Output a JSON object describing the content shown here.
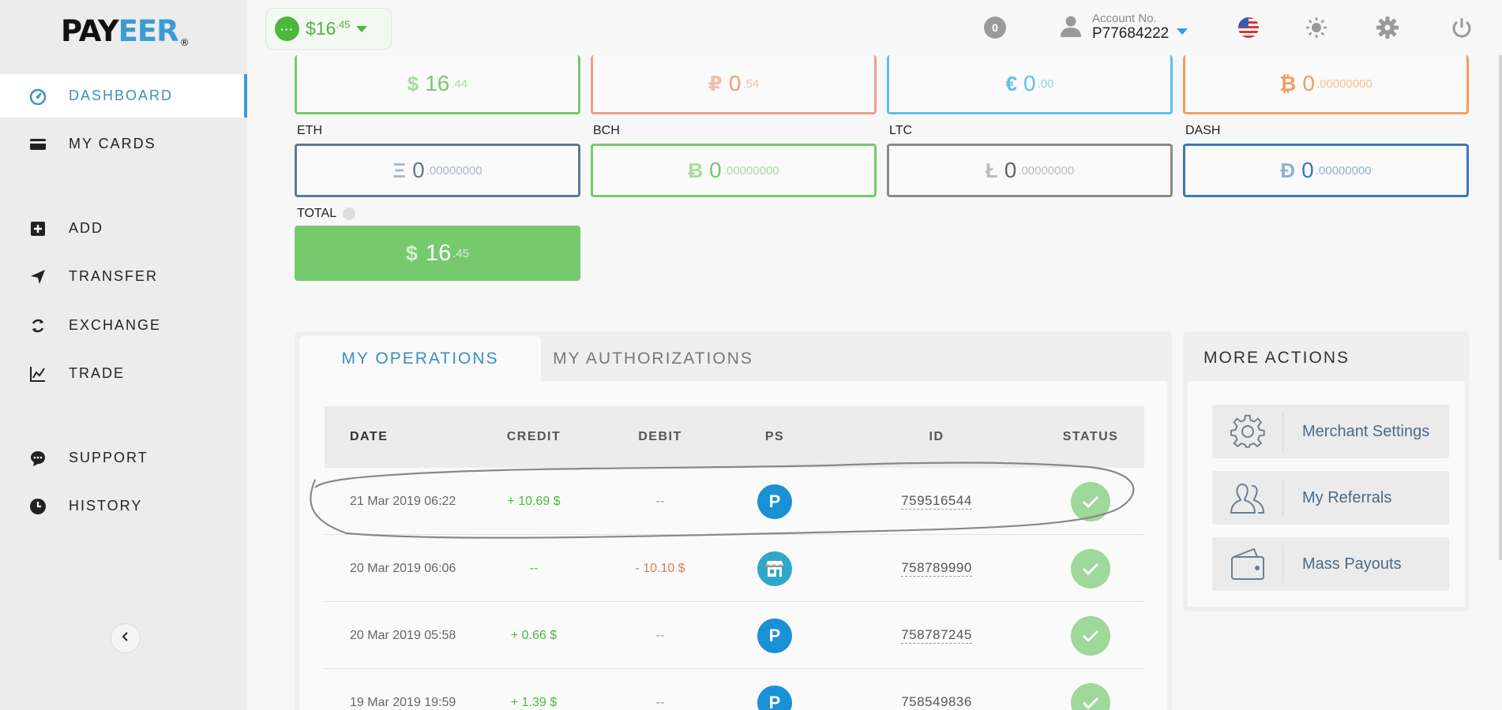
{
  "logo": {
    "part1": "PAY",
    "part2": "EER",
    "mark": "®"
  },
  "sidebar": {
    "items": [
      {
        "label": "DASHBOARD",
        "icon": "dashboard-icon",
        "active": true
      },
      {
        "label": "MY CARDS",
        "icon": "card-icon"
      },
      {
        "label": "ADD",
        "icon": "add-icon"
      },
      {
        "label": "TRANSFER",
        "icon": "transfer-icon"
      },
      {
        "label": "EXCHANGE",
        "icon": "exchange-icon"
      },
      {
        "label": "TRADE",
        "icon": "trade-icon"
      },
      {
        "label": "SUPPORT",
        "icon": "support-icon"
      },
      {
        "label": "HISTORY",
        "icon": "history-icon"
      }
    ],
    "collapse_icon": "chevron-left-icon"
  },
  "topbar": {
    "balance_main": "$16",
    "balance_frac": ".45",
    "notifications": "0",
    "account_label": "Account No.",
    "account_number": "P77684222"
  },
  "wallets": {
    "row1": [
      {
        "symbol": "$",
        "amount": "16",
        "frac": ".44",
        "color": "#77c96d"
      },
      {
        "symbol": "₽",
        "amount": "0",
        "frac": ".54",
        "color": "#e9a08a"
      },
      {
        "symbol": "€",
        "amount": "0",
        "frac": ".00",
        "color": "#5bc2e7"
      },
      {
        "symbol": "₿",
        "amount": "0",
        "frac": ".00000000",
        "color": "#f0a060"
      }
    ],
    "row2": [
      {
        "code": "ETH",
        "symbol": "Ξ",
        "amount": "0",
        "frac": ".00000000",
        "color": "#5e7a95"
      },
      {
        "code": "BCH",
        "symbol": "Ƀ",
        "amount": "0",
        "frac": ".00000000",
        "color": "#77c96d"
      },
      {
        "code": "LTC",
        "symbol": "Ł",
        "amount": "0",
        "frac": ".00000000",
        "color": "#8a8a8a"
      },
      {
        "code": "DASH",
        "symbol": "Đ",
        "amount": "0",
        "frac": ".00000000",
        "color": "#3b78b5"
      }
    ],
    "total_label": "TOTAL",
    "total": {
      "symbol": "$",
      "amount": "16",
      "frac": ".45"
    }
  },
  "operations": {
    "tabs": [
      "MY OPERATIONS",
      "MY AUTHORIZATIONS"
    ],
    "headers": [
      "DATE",
      "CREDIT",
      "DEBIT",
      "PS",
      "ID",
      "STATUS"
    ],
    "rows": [
      {
        "date": "21 Mar 2019 06:22",
        "credit": "+ 10.69 $",
        "debit": "--",
        "ps": "payeer",
        "id": "759516544",
        "status": "ok"
      },
      {
        "date": "20 Mar 2019 06:06",
        "credit": "--",
        "debit": "- 10.10 $",
        "ps": "shop",
        "id": "758789990",
        "status": "ok"
      },
      {
        "date": "20 Mar 2019 05:58",
        "credit": "+ 0.66 $",
        "debit": "--",
        "ps": "payeer",
        "id": "758787245",
        "status": "ok"
      },
      {
        "date": "19 Mar 2019 19:59",
        "credit": "+ 1.39 $",
        "debit": "--",
        "ps": "payeer",
        "id": "758549836",
        "status": "ok"
      }
    ],
    "ps_letter": "P"
  },
  "more_actions": {
    "title": "MORE ACTIONS",
    "items": [
      {
        "label": "Merchant Settings",
        "icon": "gear-icon"
      },
      {
        "label": "My Referrals",
        "icon": "users-icon"
      },
      {
        "label": "Mass Payouts",
        "icon": "wallet-icon"
      }
    ]
  }
}
